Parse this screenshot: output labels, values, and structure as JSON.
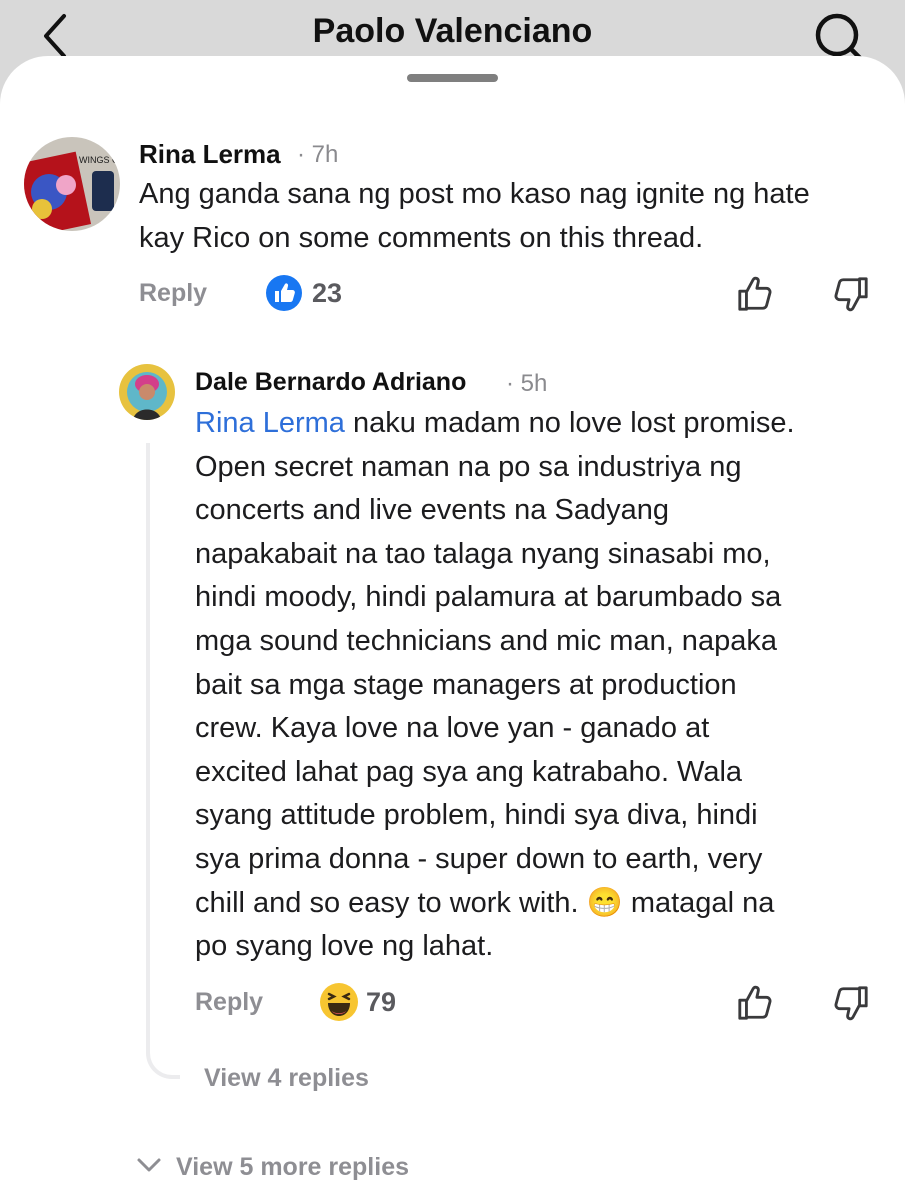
{
  "header": {
    "title": "Paolo Valenciano"
  },
  "comments": [
    {
      "author": "Rina Lerma",
      "time": "· 7h",
      "text": "Ang ganda sana ng post mo kaso nag ignite ng hate kay Rico on some comments on this thread.",
      "reply_label": "Reply",
      "reaction": "like",
      "reaction_count": "23",
      "avatar_text": "WINGS GREA"
    },
    {
      "author": "Dale Bernardo Adriano",
      "time": "· 5h",
      "mention": "Rina Lerma",
      "text_lines": [
        " naku madam no love lost promise.",
        "Open secret naman na po sa industriya ng",
        "concerts and live events na Sadyang",
        "napakabait na tao talaga nyang sinasabi mo,",
        "hindi moody, hindi palamura at barumbado sa",
        "mga sound technicians and mic man, napaka",
        "bait sa mga stage managers at production",
        "crew. Kaya love na love yan - ganado at",
        "excited lahat pag sya ang katrabaho. Wala",
        "syang attitude problem, hindi sya diva, hindi",
        "sya prima donna - super down to earth, very",
        "chill and so easy to work with. 😁 matagal na",
        "po syang love ng lahat."
      ],
      "reply_label": "Reply",
      "reaction": "haha",
      "reaction_count": "79",
      "view_replies": "View 4 replies"
    }
  ],
  "view_more_replies": "View 5 more replies",
  "colors": {
    "mention": "#2e6fd9",
    "like": "#1877f2",
    "haha": "#f7c531"
  }
}
